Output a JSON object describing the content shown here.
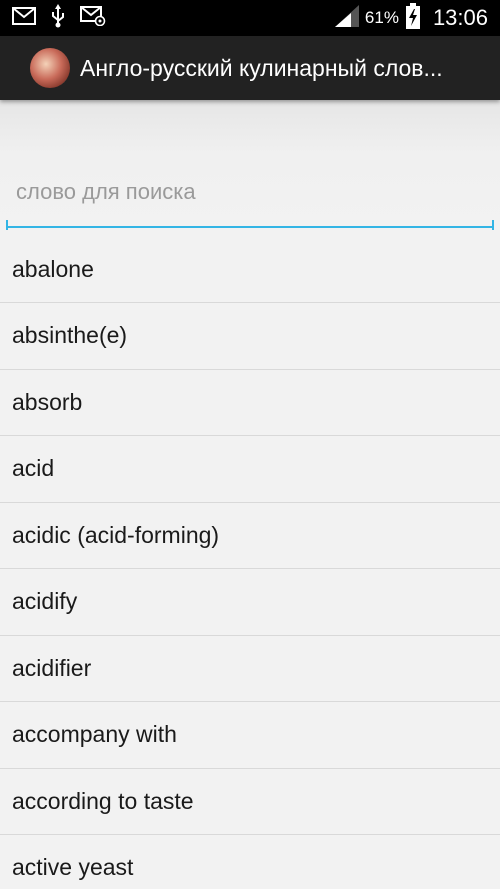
{
  "status_bar": {
    "icons": [
      "mail-icon",
      "usb-icon",
      "email-icon",
      "signal-icon",
      "battery-charging-icon"
    ],
    "battery_percent": "61%",
    "time": "13:06"
  },
  "action_bar": {
    "title": "Англо-русский кулинарный слов..."
  },
  "search": {
    "placeholder": "слово для поиска",
    "value": ""
  },
  "words": [
    "abalone",
    "absinthe(e)",
    "absorb",
    "acid",
    "acidic (acid-forming)",
    "acidify",
    "acidifier",
    "accompany with",
    "according to taste",
    "active yeast"
  ],
  "colors": {
    "accent": "#33b5e5",
    "action_bar": "#222222",
    "status_bar": "#000000",
    "background": "#f2f2f2"
  }
}
